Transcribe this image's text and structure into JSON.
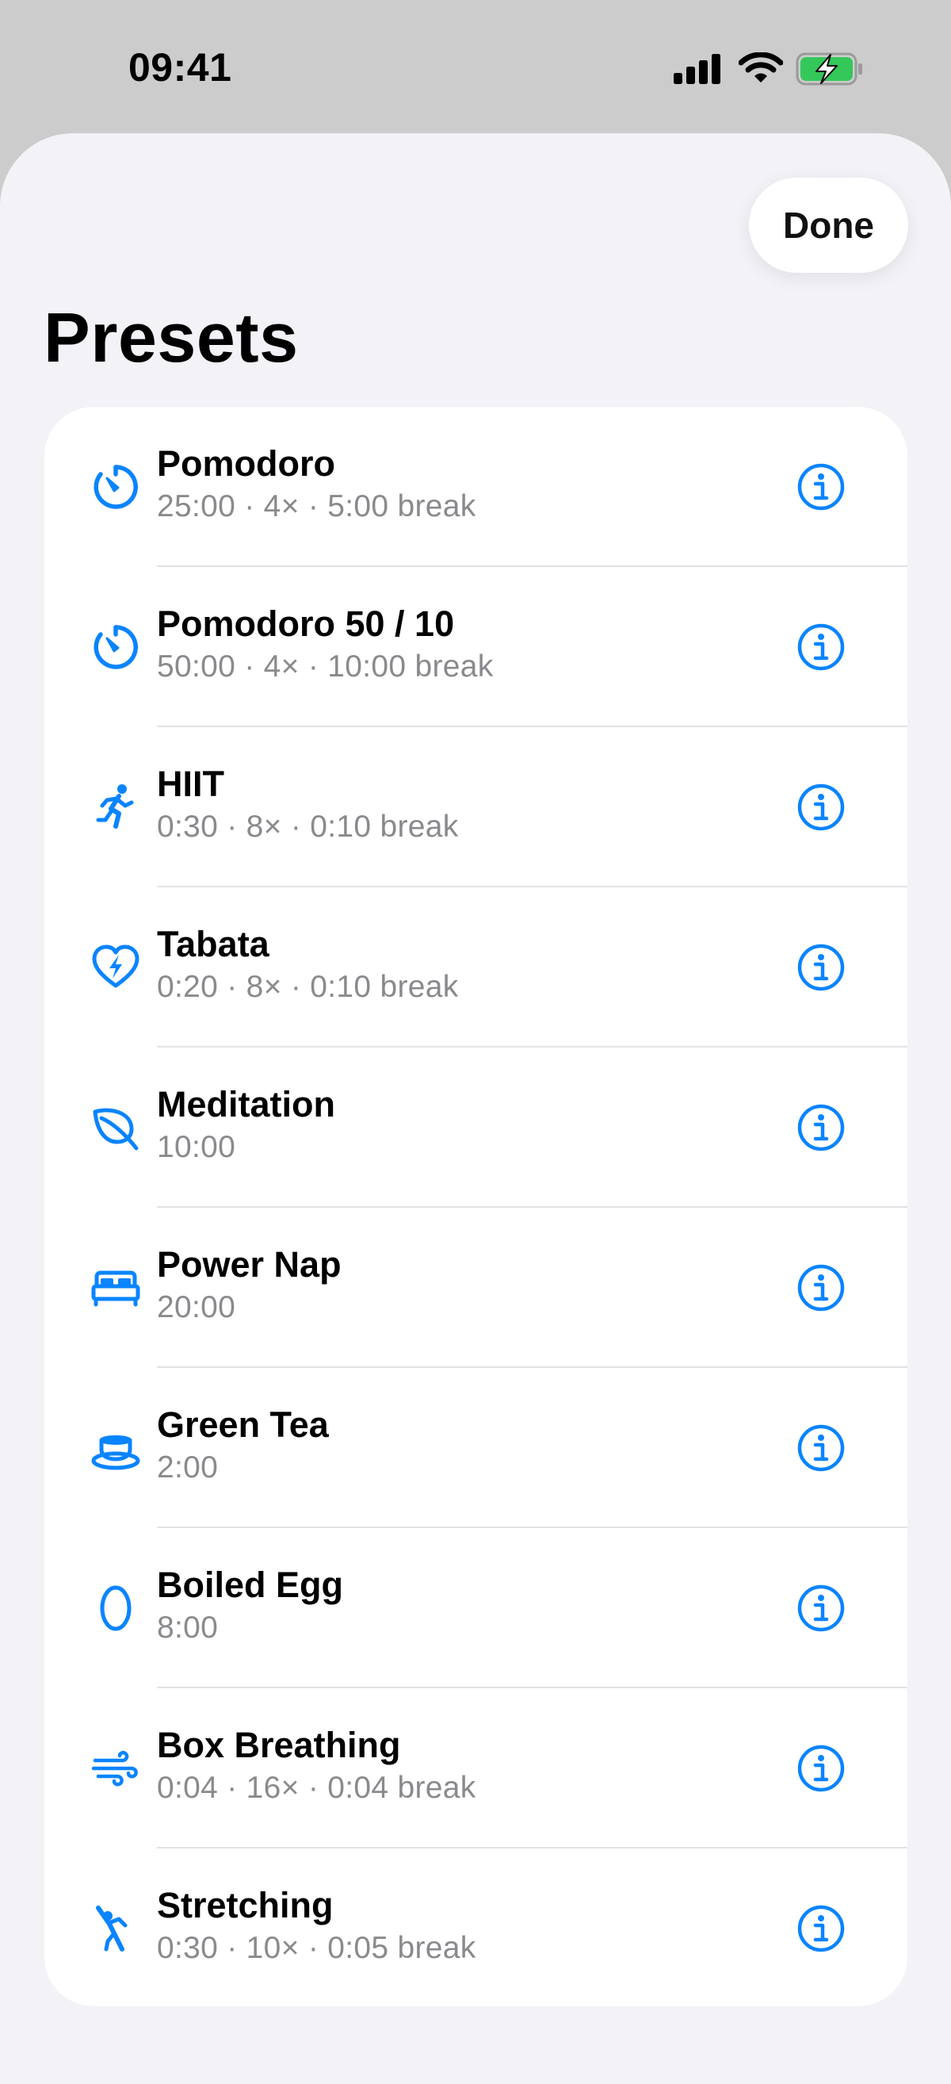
{
  "status_bar": {
    "time": "09:41"
  },
  "header": {
    "done_label": "Done",
    "title": "Presets"
  },
  "accent_color": "#0a84ff",
  "presets": [
    {
      "icon": "timer-icon",
      "title": "Pomodoro",
      "subtitle": "25:00 · 4× · 5:00 break"
    },
    {
      "icon": "timer-icon",
      "title": "Pomodoro 50 / 10",
      "subtitle": "50:00 · 4× · 10:00 break"
    },
    {
      "icon": "running-figure-icon",
      "title": "HIIT",
      "subtitle": "0:30 · 8× · 0:10 break"
    },
    {
      "icon": "heart-bolt-icon",
      "title": "Tabata",
      "subtitle": "0:20 · 8× · 0:10 break"
    },
    {
      "icon": "leaf-icon",
      "title": "Meditation",
      "subtitle": "10:00"
    },
    {
      "icon": "bed-icon",
      "title": "Power Nap",
      "subtitle": "20:00"
    },
    {
      "icon": "teacup-icon",
      "title": "Green Tea",
      "subtitle": "2:00"
    },
    {
      "icon": "egg-icon",
      "title": "Boiled Egg",
      "subtitle": "8:00"
    },
    {
      "icon": "wind-icon",
      "title": "Box Breathing",
      "subtitle": "0:04 · 16× · 0:04 break"
    },
    {
      "icon": "stretching-figure-icon",
      "title": "Stretching",
      "subtitle": "0:30 · 10× · 0:05 break"
    }
  ]
}
